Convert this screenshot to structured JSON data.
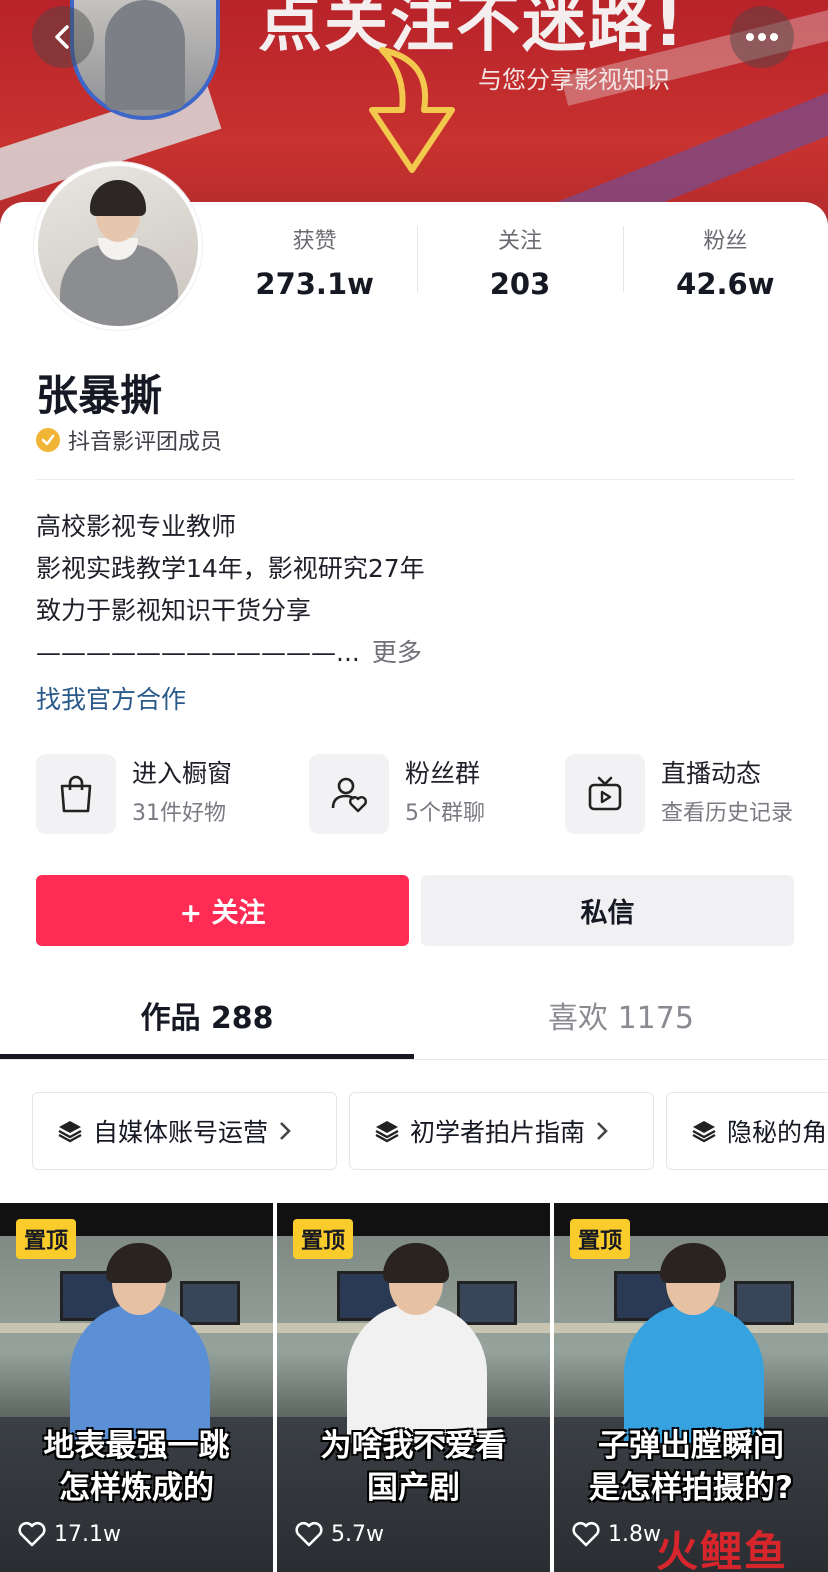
{
  "banner": {
    "title": "点关注不迷路!",
    "subtitle": "与您分享影视知识"
  },
  "nav": {
    "back_icon": "chevron-left-icon",
    "more_icon": "ellipsis-icon"
  },
  "profile": {
    "name": "张暴撕",
    "badge": "抖音影评团成员",
    "stats": [
      {
        "label": "获赞",
        "value": "273.1w"
      },
      {
        "label": "关注",
        "value": "203"
      },
      {
        "label": "粉丝",
        "value": "42.6w"
      }
    ],
    "bio": [
      "高校影视专业教师",
      "影视实践教学14年，影视研究27年",
      "致力于影视知识干货分享",
      "————————————..."
    ],
    "bio_more": "更多",
    "coop_link": "找我官方合作"
  },
  "features": [
    {
      "title": "进入橱窗",
      "sub": "31件好物",
      "icon": "shopping-bag-icon"
    },
    {
      "title": "粉丝群",
      "sub": "5个群聊",
      "icon": "fan-group-icon"
    },
    {
      "title": "直播动态",
      "sub": "查看历史记录",
      "icon": "live-tv-icon"
    }
  ],
  "actions": {
    "follow": "+ 关注",
    "message": "私信"
  },
  "tabs": [
    {
      "label": "作品 288",
      "active": true
    },
    {
      "label": "喜欢 1175",
      "active": false
    }
  ],
  "collections": [
    {
      "label": "自媒体账号运营"
    },
    {
      "label": "初学者拍片指南"
    },
    {
      "label": "隐秘的角"
    }
  ],
  "videos": [
    {
      "pinned": "置顶",
      "caption_line1": "地表最强一跳",
      "caption_line2": "怎样炼成的",
      "likes": "17.1w"
    },
    {
      "pinned": "置顶",
      "caption_line1": "为啥我不爱看",
      "caption_line2": "国产剧",
      "likes": "5.7w"
    },
    {
      "pinned": "置顶",
      "caption_line1": "子弹出膛瞬间",
      "caption_line2": "是怎样拍摄的?",
      "likes": "1.8w"
    }
  ],
  "watermark": "火鲤鱼",
  "colors": {
    "follow": "#fe2c55",
    "link": "#2a5a8a",
    "pinned": "#f9cc2c",
    "badge": "#f1b535"
  }
}
